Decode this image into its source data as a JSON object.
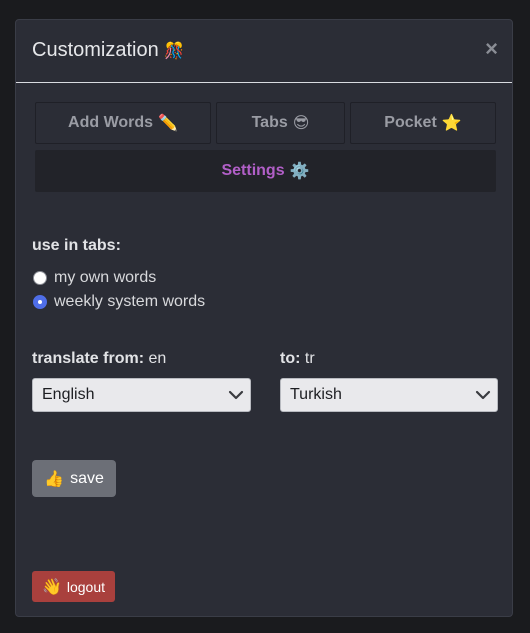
{
  "modal": {
    "title": "Customization",
    "title_emoji": "🎊",
    "close_label": "×"
  },
  "tabs": [
    {
      "label": "Add Words",
      "emoji": "✏️",
      "active": false
    },
    {
      "label": "Tabs",
      "emoji": "😎",
      "active": false
    },
    {
      "label": "Pocket",
      "emoji": "⭐",
      "active": false
    },
    {
      "label": "Settings",
      "emoji": "⚙️",
      "active": true
    }
  ],
  "settings": {
    "use_in_tabs_label": "use in tabs:",
    "radio_options": [
      {
        "label": "my own words",
        "checked": false
      },
      {
        "label": "weekly system words",
        "checked": true
      }
    ],
    "translate_from_label": "translate from:",
    "translate_from_code": "en",
    "to_label": "to:",
    "to_code": "tr",
    "from_select_value": "English",
    "to_select_value": "Turkish"
  },
  "buttons": {
    "save_label": "save",
    "save_emoji": "👍",
    "logout_label": "logout",
    "logout_emoji": "👋"
  },
  "colors": {
    "active_tab_text": "#b25fc8",
    "radio_checked": "#4f6ee8",
    "save_bg": "#6c6f77",
    "logout_bg": "#a9403d"
  }
}
